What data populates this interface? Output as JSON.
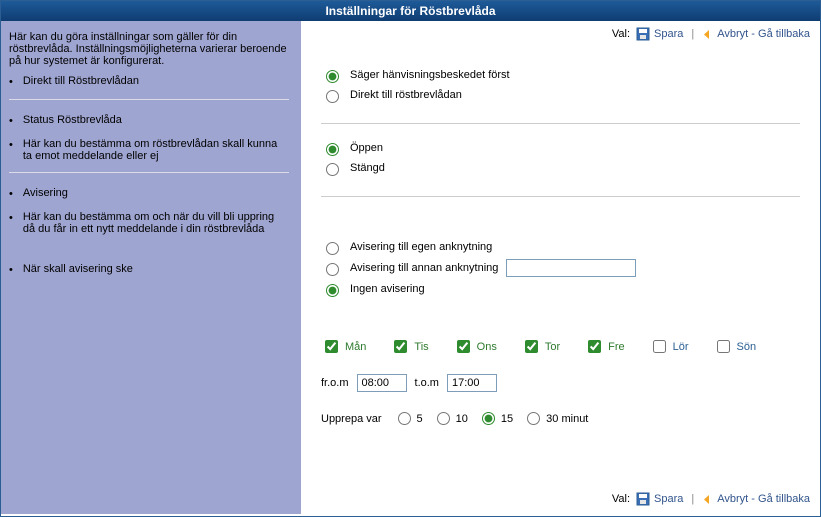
{
  "title": "Inställningar för Röstbrevlåda",
  "left": {
    "intro": "Här kan du göra inställningar som gäller för din röstbrevlåda. Inställningsmöjligheterna varierar beroende på hur systemet är konfigurerat.",
    "sec1_item1": "Direkt till Röstbrevlådan",
    "sec2_item1": "Status Röstbrevlåda",
    "sec2_item2": "Här kan du bestämma om röstbrevlådan skall kunna ta emot meddelande eller ej",
    "sec3_item1": "Avisering",
    "sec3_item2": "Här kan du bestämma om och när du vill bli uppring då du får in ett nytt meddelande i din röstbrevlåda",
    "sec3_item3": "När skall avisering ske"
  },
  "toolbar": {
    "val": "Val:",
    "save": "Spara",
    "cancel": "Avbryt - Gå tillbaka"
  },
  "direct": {
    "opt1": "Säger hänvisningsbeskedet först",
    "opt2": "Direkt till röstbrevlådan"
  },
  "status": {
    "opt1": "Öppen",
    "opt2": "Stängd"
  },
  "avisering": {
    "opt1": "Avisering till egen anknytning",
    "opt2": "Avisering till annan anknytning",
    "opt2_value": "",
    "opt3": "Ingen avisering"
  },
  "days": {
    "mon": "Mån",
    "tue": "Tis",
    "wed": "Ons",
    "thu": "Tor",
    "fri": "Fre",
    "sat": "Lör",
    "sun": "Sön"
  },
  "time": {
    "from_label": "fr.o.m",
    "from_value": "08:00",
    "to_label": "t.o.m",
    "to_value": "17:00"
  },
  "repeat": {
    "label": "Upprepa var",
    "o5": "5",
    "o10": "10",
    "o15": "15",
    "o30": "30 minut"
  }
}
